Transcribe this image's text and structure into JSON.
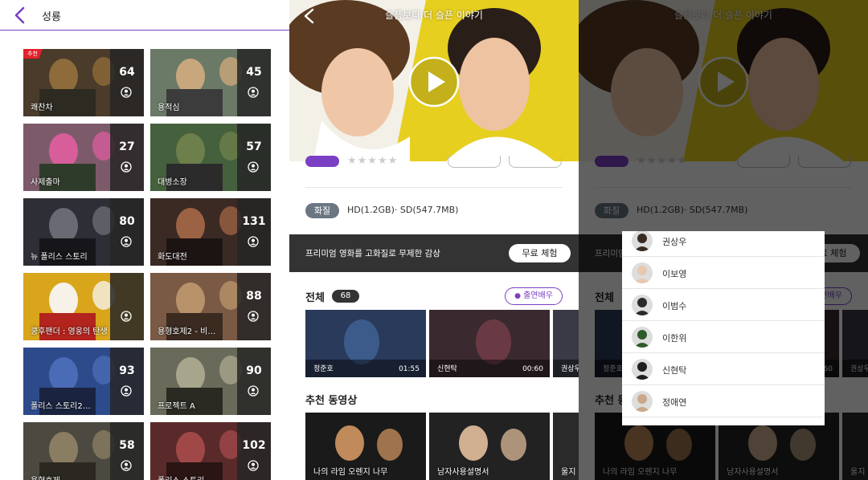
{
  "list_screen": {
    "title": "성룡",
    "badge": "추천",
    "cards": [
      {
        "title": "쾌찬차",
        "count": "64",
        "recommended": true
      },
      {
        "title": "용적심",
        "count": "45"
      },
      {
        "title": "사제출마",
        "count": "27"
      },
      {
        "title": "대병소장",
        "count": "57"
      },
      {
        "title": "뉴 폴리스 스토리",
        "count": "80"
      },
      {
        "title": "화도대전",
        "count": "131"
      },
      {
        "title": "쿵후팬더 : 영웅의 탄생",
        "count": ""
      },
      {
        "title": "용형호제2 - 비…",
        "count": "88"
      },
      {
        "title": "폴리스 스토리2…",
        "count": "93"
      },
      {
        "title": "프로젝트 A",
        "count": "90"
      },
      {
        "title": "용형호제",
        "count": "58"
      },
      {
        "title": "폴리스 스토리",
        "count": "102"
      }
    ]
  },
  "detail_screen": {
    "title": "슬픔보다 더 슬픈 이야기",
    "quality_label": "화질",
    "quality_value": "HD(1.2GB)· SD(547.7MB)",
    "promo_text": "프리미엄 영화를 고화질로 무제한 감상",
    "promo_button": "무료 체험",
    "all_label": "전체",
    "all_count": "68",
    "cast_button": "출연배우",
    "clips": [
      {
        "actor": "정준호",
        "duration": "01:55"
      },
      {
        "actor": "신현탁",
        "duration": "00:60"
      },
      {
        "actor": "권상우",
        "duration": ""
      }
    ],
    "recommended_label": "추천 동영상",
    "recommended": [
      {
        "title": "나의 라임 오렌지 나무"
      },
      {
        "title": "남자사용설명서"
      },
      {
        "title": "울지"
      }
    ]
  },
  "cast_popup": {
    "cast": [
      "권상우",
      "이보영",
      "이범수",
      "이한위",
      "신현탁",
      "정애연"
    ]
  },
  "colors": {
    "accent": "#7b3fc4",
    "badge_red": "#e3212b",
    "hero_yellow": "#e6cf1f",
    "promo_bg": "#333333"
  }
}
